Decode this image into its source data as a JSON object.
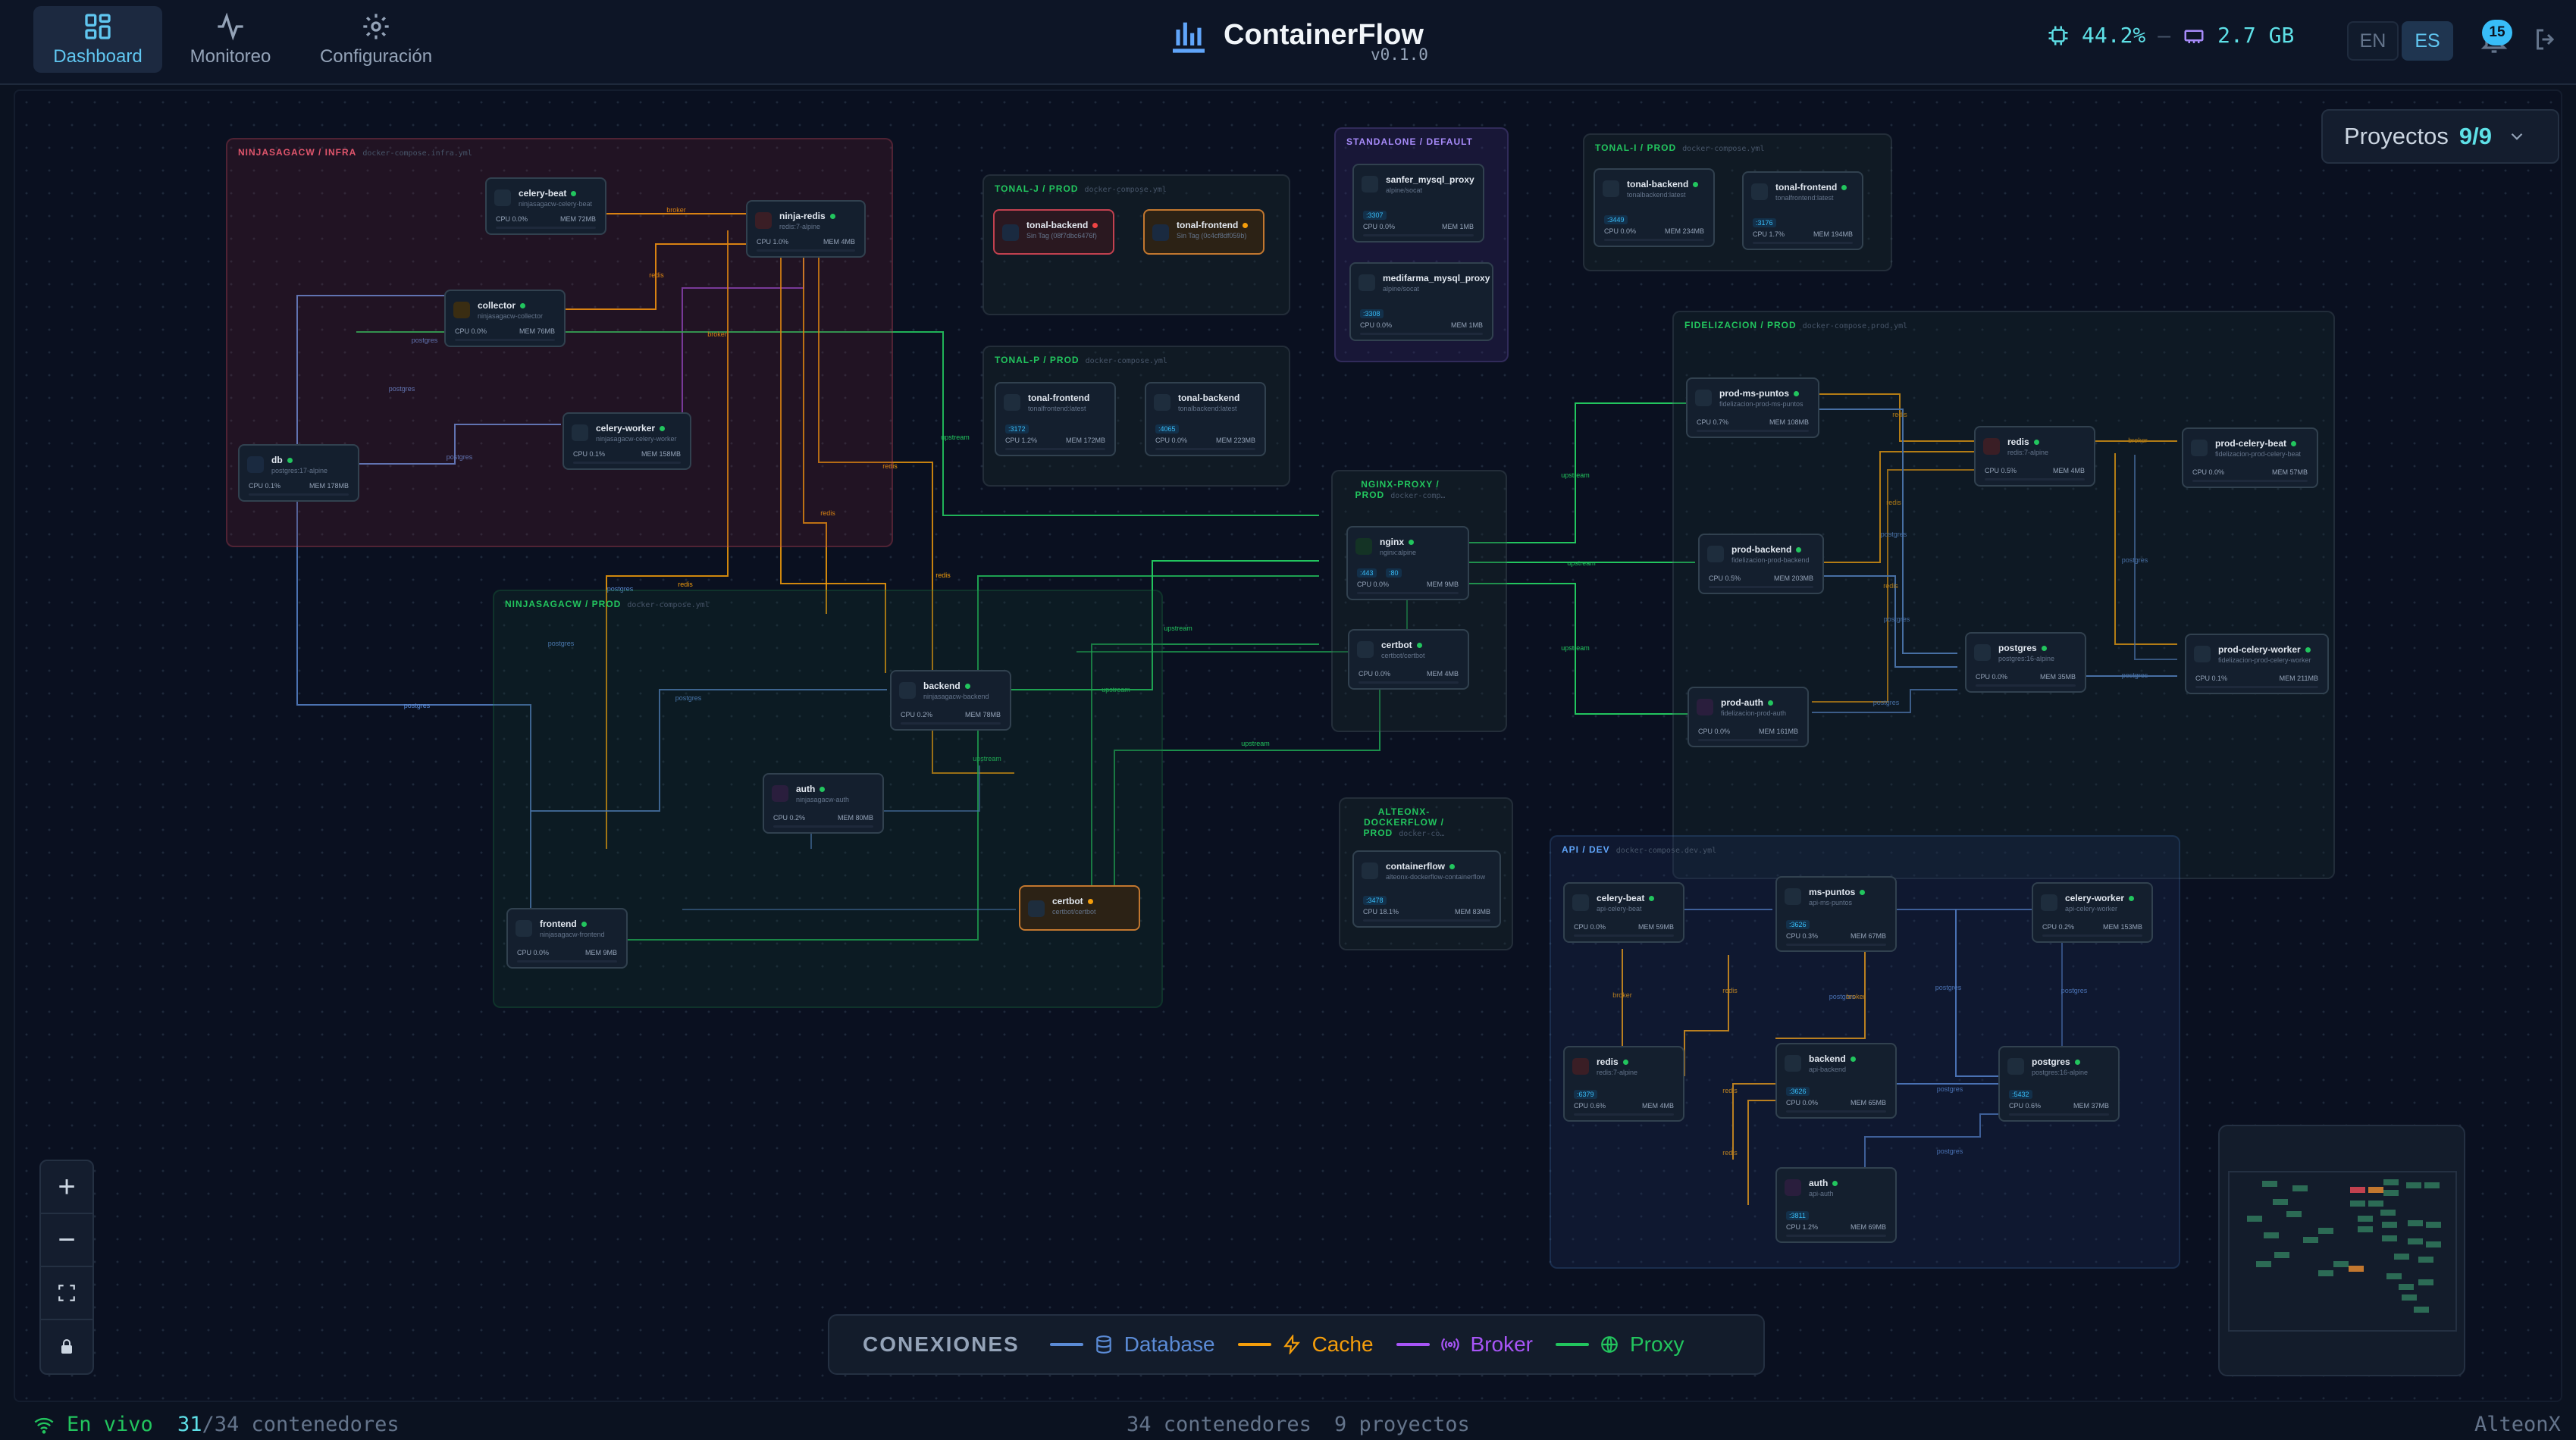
{
  "nav": {
    "tabs": [
      {
        "label": "Dashboard",
        "icon": "grid-icon",
        "active": true
      },
      {
        "label": "Monitoreo",
        "icon": "activity-icon",
        "active": false
      },
      {
        "label": "Configuración",
        "icon": "gear-icon",
        "active": false
      }
    ]
  },
  "brand": {
    "name": "ContainerFlow",
    "version": "v0.1.0",
    "icon": "bar-chart-logo-icon"
  },
  "system": {
    "cpu": "44.2%",
    "separator": "—",
    "memory": "2.7 GB",
    "cpu_icon": "cpu-icon",
    "mem_icon": "memory-icon"
  },
  "languages": {
    "en": "EN",
    "es": "ES",
    "selected": "ES"
  },
  "notifications": {
    "count": "15",
    "icon": "bell-icon"
  },
  "logout_icon": "logout-icon",
  "projects": {
    "label": "Proyectos",
    "count": "9/9",
    "icon": "chevron-down-icon"
  },
  "colors": {
    "database": "#5b8bd6",
    "cache": "#f59e0b",
    "broker": "#a855f7",
    "proxy": "#22c55e",
    "accent": "#5ee0e7"
  },
  "groups": {
    "g1": {
      "title": "NINJASAGACW / INFRA",
      "file": "docker-compose.infra.yml",
      "color": "#e0556c"
    },
    "g2": {
      "title": "NINJASAGACW / PROD",
      "file": "docker-compose.yml",
      "color": "#22c55e"
    },
    "g3": {
      "title": "TONAL-J / PROD",
      "file": "docker-compose.yml",
      "color": "#22c55e"
    },
    "g4": {
      "title": "TONAL-P / PROD",
      "file": "docker-compose.yml",
      "color": "#22c55e"
    },
    "g5": {
      "title": "STANDALONE / DEFAULT",
      "file": "",
      "color": "#a78bfa"
    },
    "g6": {
      "title": "TONAL-I / PROD",
      "file": "docker-compose.yml",
      "color": "#22c55e"
    },
    "g7": {
      "title": "NGINX-PROXY / PROD",
      "file": "docker-comp…",
      "color": "#22c55e"
    },
    "g8": {
      "title": "FIDELIZACION / PROD",
      "file": "docker-compose.prod.yml",
      "color": "#22c55e"
    },
    "g9": {
      "title": "ALTEONX-DOCKERFLOW / PROD",
      "file": "docker-co…",
      "color": "#22c55e"
    },
    "g10": {
      "title": "API / DEV",
      "file": "docker-compose.dev.yml",
      "color": "#60a5fa"
    }
  },
  "nodes": {
    "n1": {
      "name": "celery-beat",
      "image": "ninjasagacw-celery-beat",
      "cpu": "CPU 0.0%",
      "mem": "MEM 72MB"
    },
    "n2": {
      "name": "ninja-redis",
      "image": "redis:7-alpine",
      "cpu": "CPU 1.0%",
      "mem": "MEM 4MB"
    },
    "n3": {
      "name": "collector",
      "image": "ninjasagacw-collector",
      "cpu": "CPU 0.0%",
      "mem": "MEM 76MB"
    },
    "n4": {
      "name": "celery-worker",
      "image": "ninjasagacw-celery-worker",
      "cpu": "CPU 0.1%",
      "mem": "MEM 158MB"
    },
    "n5": {
      "name": "db",
      "image": "postgres:17-alpine",
      "cpu": "CPU 0.1%",
      "mem": "MEM 178MB"
    },
    "n6": {
      "name": "tonal-backend",
      "image": "Sin Tag (08f7dbc6476f)",
      "cpu": "",
      "mem": ""
    },
    "n7": {
      "name": "tonal-frontend",
      "image": "Sin Tag (0c4cf8df059b)",
      "cpu": "",
      "mem": ""
    },
    "n8": {
      "name": "tonal-frontend",
      "image": "tonalfrontend:latest",
      "port": ":3172",
      "cpu": "CPU 1.2%",
      "mem": "MEM 172MB"
    },
    "n9": {
      "name": "tonal-backend",
      "image": "tonalbackend:latest",
      "port": ":4065",
      "cpu": "CPU 0.0%",
      "mem": "MEM 223MB"
    },
    "n10": {
      "name": "sanfer_mysql_proxy",
      "image": "alpine/socat",
      "port": ":3307",
      "cpu": "CPU 0.0%",
      "mem": "MEM 1MB"
    },
    "n11": {
      "name": "medifarma_mysql_proxy",
      "image": "alpine/socat",
      "port": ":3308",
      "cpu": "CPU 0.0%",
      "mem": "MEM 1MB"
    },
    "n12": {
      "name": "tonal-backend",
      "image": "tonalbackend:latest",
      "port": ":3449",
      "cpu": "CPU 0.0%",
      "mem": "MEM 234MB"
    },
    "n13": {
      "name": "tonal-frontend",
      "image": "tonalfrontend:latest",
      "port": ":3176",
      "cpu": "CPU 1.7%",
      "mem": "MEM 194MB"
    },
    "n14": {
      "name": "nginx",
      "image": "nginx:alpine",
      "port": ":443",
      "port2": ":80",
      "cpu": "CPU 0.0%",
      "mem": "MEM 9MB"
    },
    "n15": {
      "name": "certbot",
      "image": "certbot/certbot",
      "cpu": "CPU 0.0%",
      "mem": "MEM 4MB"
    },
    "n16": {
      "name": "prod-ms-puntos",
      "image": "fidelizacion-prod-ms-puntos",
      "cpu": "CPU 0.7%",
      "mem": "MEM 108MB"
    },
    "n17": {
      "name": "redis",
      "image": "redis:7-alpine",
      "cpu": "CPU 0.5%",
      "mem": "MEM 4MB"
    },
    "n18": {
      "name": "prod-celery-beat",
      "image": "fidelizacion-prod-celery-beat",
      "cpu": "CPU 0.0%",
      "mem": "MEM 57MB"
    },
    "n19": {
      "name": "prod-backend",
      "image": "fidelizacion-prod-backend",
      "cpu": "CPU 0.5%",
      "mem": "MEM 203MB"
    },
    "n20": {
      "name": "postgres",
      "image": "postgres:16-alpine",
      "cpu": "CPU 0.0%",
      "mem": "MEM 35MB"
    },
    "n21": {
      "name": "prod-celery-worker",
      "image": "fidelizacion-prod-celery-worker",
      "cpu": "CPU 0.1%",
      "mem": "MEM 211MB"
    },
    "n22": {
      "name": "prod-auth",
      "image": "fidelizacion-prod-auth",
      "cpu": "CPU 0.0%",
      "mem": "MEM 161MB"
    },
    "n23": {
      "name": "backend",
      "image": "ninjasagacw-backend",
      "cpu": "CPU 0.2%",
      "mem": "MEM 78MB"
    },
    "n24": {
      "name": "auth",
      "image": "ninjasagacw-auth",
      "cpu": "CPU 0.2%",
      "mem": "MEM 80MB"
    },
    "n25": {
      "name": "frontend",
      "image": "ninjasagacw-frontend",
      "cpu": "CPU 0.0%",
      "mem": "MEM 9MB"
    },
    "n26": {
      "name": "certbot",
      "image": "certbot/certbot",
      "cpu": "",
      "mem": ""
    },
    "n27": {
      "name": "containerflow",
      "image": "alteonx-dockerflow-containerflow",
      "port": ":3478",
      "cpu": "CPU 18.1%",
      "mem": "MEM 83MB"
    },
    "n28": {
      "name": "celery-beat",
      "image": "api-celery-beat",
      "cpu": "CPU 0.0%",
      "mem": "MEM 59MB"
    },
    "n29": {
      "name": "ms-puntos",
      "image": "api-ms-puntos",
      "port": ":3626",
      "cpu": "CPU 0.3%",
      "mem": "MEM 67MB"
    },
    "n30": {
      "name": "celery-worker",
      "image": "api-celery-worker",
      "cpu": "CPU 0.2%",
      "mem": "MEM 153MB"
    },
    "n31": {
      "name": "redis",
      "image": "redis:7-alpine",
      "port": ":6379",
      "cpu": "CPU 0.6%",
      "mem": "MEM 4MB"
    },
    "n32": {
      "name": "backend",
      "image": "api-backend",
      "port": ":3626",
      "cpu": "CPU 0.0%",
      "mem": "MEM 65MB"
    },
    "n33": {
      "name": "postgres",
      "image": "postgres:16-alpine",
      "port": ":5432",
      "cpu": "CPU 0.6%",
      "mem": "MEM 37MB"
    },
    "n34": {
      "name": "auth",
      "image": "api-auth",
      "port": ":3811",
      "cpu": "CPU 1.2%",
      "mem": "MEM 69MB"
    }
  },
  "edge_labels": {
    "broker": "broker",
    "redis": "redis",
    "postgres": "postgres",
    "upstream": "upstream"
  },
  "legend": {
    "title": "CONEXIONES",
    "items": [
      {
        "label": "Database",
        "icon": "database-icon",
        "color": "#5b8bd6"
      },
      {
        "label": "Cache",
        "icon": "bolt-icon",
        "color": "#f59e0b"
      },
      {
        "label": "Broker",
        "icon": "broadcast-icon",
        "color": "#a855f7"
      },
      {
        "label": "Proxy",
        "icon": "globe-icon",
        "color": "#22c55e"
      }
    ]
  },
  "zoom": {
    "icons": [
      "plus-icon",
      "minus-icon",
      "fit-view-icon",
      "lock-icon"
    ]
  },
  "status": {
    "live_label": "En vivo",
    "running": "31",
    "total": "/34 contenedores",
    "center_containers": "34 contenedores",
    "center_projects": "9 proyectos",
    "brand": "AlteonX",
    "wifi_icon": "wifi-icon"
  }
}
